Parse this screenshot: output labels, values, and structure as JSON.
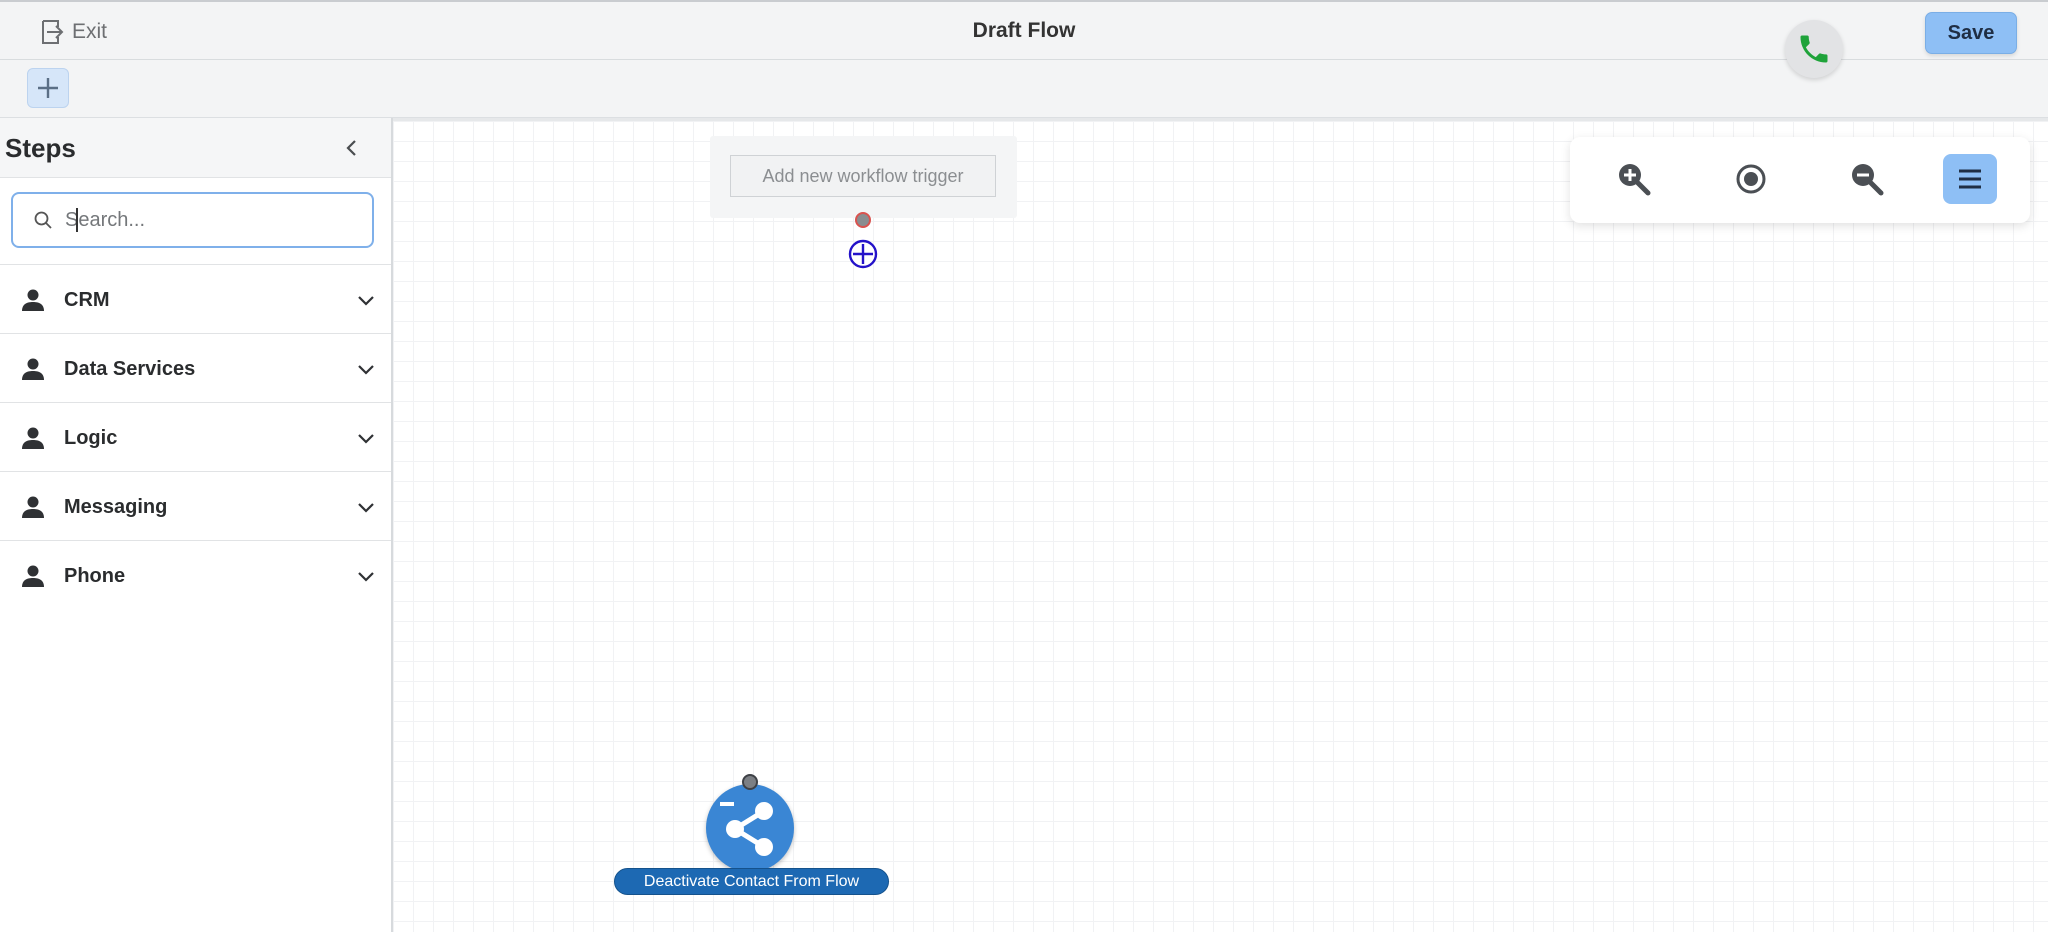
{
  "header": {
    "exit_label": "Exit",
    "title": "Draft Flow",
    "save_label": "Save"
  },
  "sidebar": {
    "title": "Steps",
    "search": {
      "placeholder": "Search...",
      "value": ""
    },
    "categories": [
      {
        "label": "CRM",
        "icon": "person-icon"
      },
      {
        "label": "Data Services",
        "icon": "person-icon"
      },
      {
        "label": "Logic",
        "icon": "person-icon"
      },
      {
        "label": "Messaging",
        "icon": "person-icon"
      },
      {
        "label": "Phone",
        "icon": "person-icon"
      }
    ]
  },
  "canvas": {
    "trigger_placeholder": "Add new workflow trigger",
    "node": {
      "label": "Deactivate Contact From Flow",
      "icon": "share-icon"
    }
  },
  "colors": {
    "accent": "#8ebff5",
    "node_blue": "#3a86d4",
    "node_label_bg": "#1d69b3",
    "phone_green": "#1fa33a",
    "add_node_blue": "#2412c9"
  }
}
